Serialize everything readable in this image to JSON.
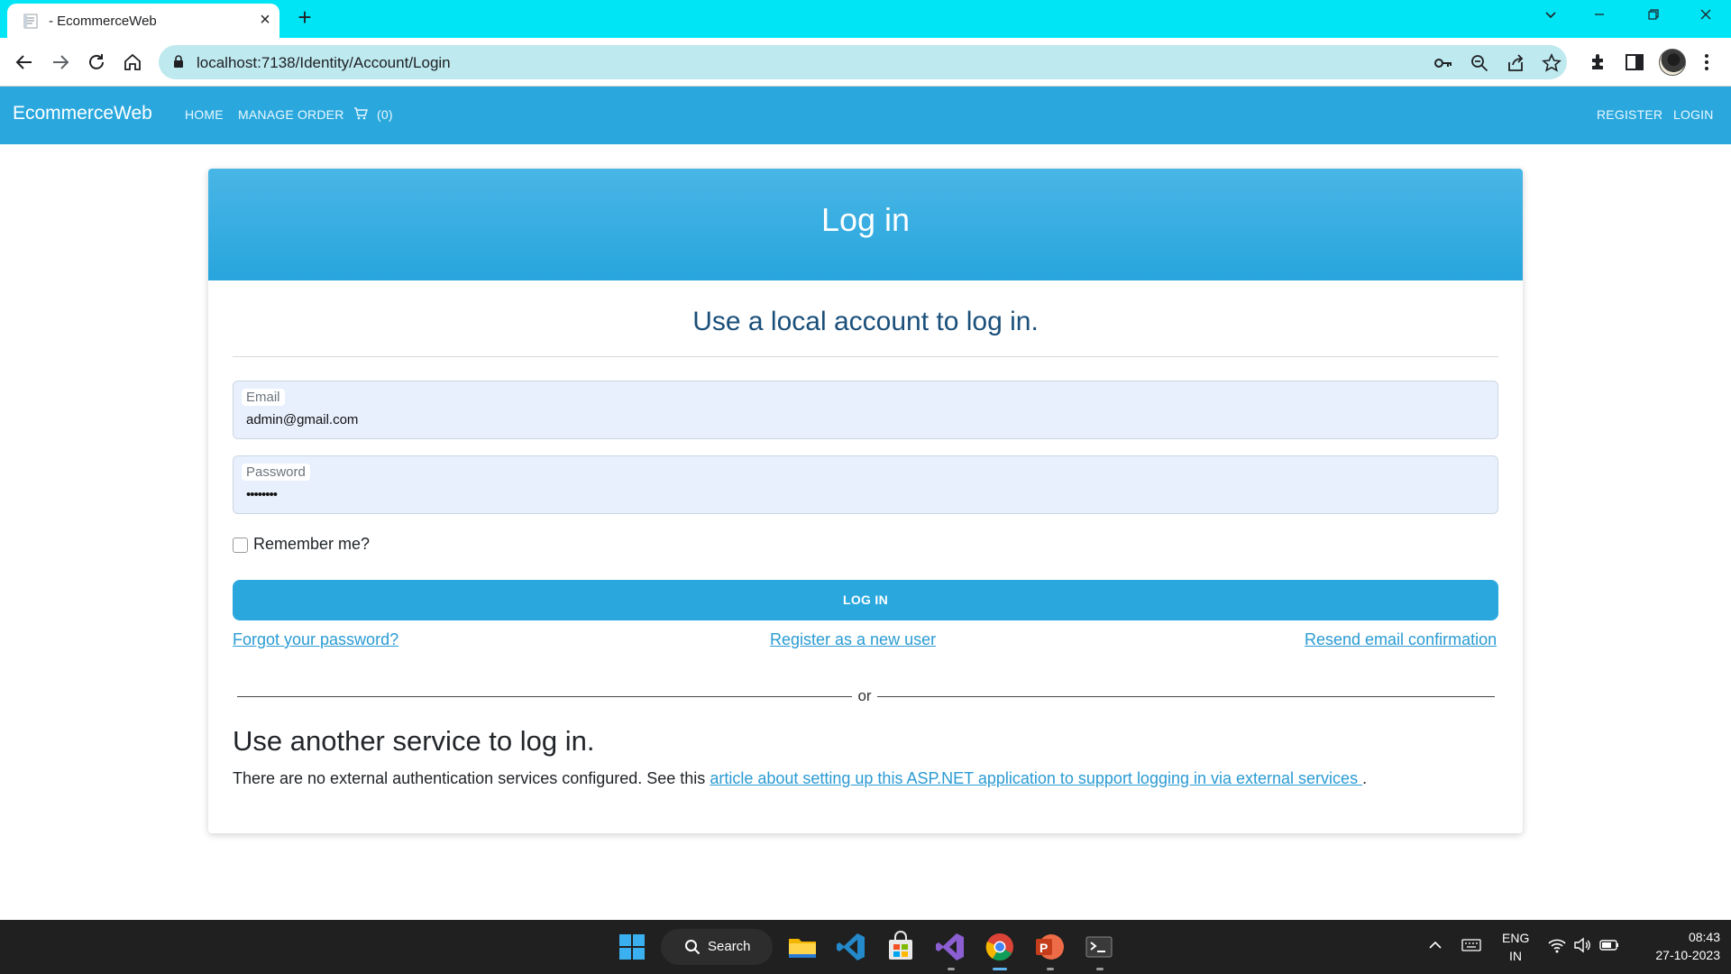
{
  "browser": {
    "tab_title": "- EcommerceWeb",
    "url": "localhost:7138/Identity/Account/Login",
    "icons": [
      "back-icon",
      "forward-icon",
      "reload-icon",
      "home-icon",
      "lock-icon",
      "key-icon",
      "zoom-icon",
      "share-icon",
      "star-icon",
      "extensions-icon",
      "sidebar-icon",
      "menu-icon"
    ]
  },
  "navbar": {
    "brand": "EcommerceWeb",
    "home": "HOME",
    "manage_order": "MANAGE ORDER",
    "cart_count": "(0)",
    "register": "REGISTER",
    "login": "LOGIN"
  },
  "card": {
    "title": "Log in",
    "subheading": "Use a local account to log in.",
    "email_label": "Email",
    "email_value": "admin@gmail.com",
    "password_label": "Password",
    "password_value": "••••••••",
    "remember_label": "Remember me?",
    "login_button": "LOG IN",
    "forgot_link": "Forgot your password?",
    "register_link": "Register as a new user",
    "resend_link": "Resend email confirmation",
    "or_text": "or",
    "other_heading": "Use another service to log in.",
    "other_text_prefix": "There are no external authentication services configured. See this ",
    "other_link": "article about setting up this ASP.NET application to support logging in via external services ",
    "other_text_suffix": "."
  },
  "taskbar": {
    "search_label": "Search",
    "lang_top": "ENG",
    "lang_bottom": "IN",
    "time": "08:43",
    "date": "27-10-2023"
  },
  "colors": {
    "tabbar": "#00e5f6",
    "navbar": "#2aa8de",
    "link": "#2a9bd3",
    "heading": "#1a4f7a"
  }
}
